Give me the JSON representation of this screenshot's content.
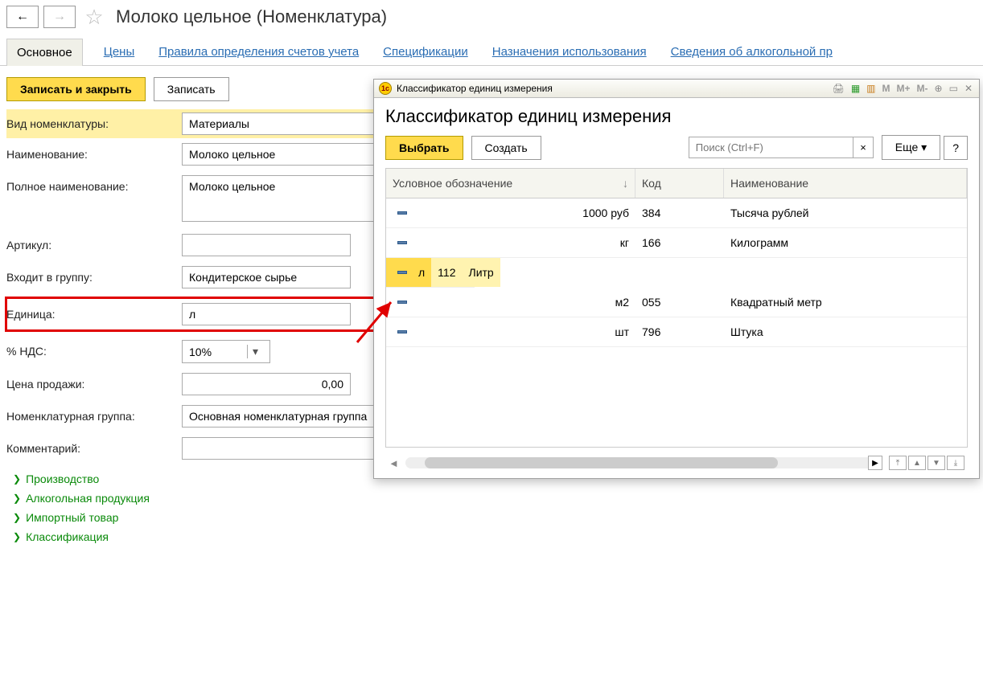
{
  "page_title": "Молоко цельное (Номенклатура)",
  "tabs": [
    "Основное",
    "Цены",
    "Правила определения счетов учета",
    "Спецификации",
    "Назначения использования",
    "Сведения об алкогольной пр"
  ],
  "toolbar": {
    "save_close": "Записать и закрыть",
    "save": "Записать"
  },
  "form": {
    "kind_label": "Вид номенклатуры:",
    "kind_value": "Материалы",
    "name_label": "Наименование:",
    "name_value": "Молоко цельное",
    "fullname_label": "Полное наименование:",
    "fullname_value": "Молоко цельное",
    "article_label": "Артикул:",
    "article_value": "",
    "group_label": "Входит в группу:",
    "group_value": "Кондитерское сырье",
    "unit_label": "Единица:",
    "unit_value": "л",
    "vat_label": "% НДС:",
    "vat_value": "10%",
    "price_label": "Цена продажи:",
    "price_value": "0,00",
    "nomgrp_label": "Номенклатурная группа:",
    "nomgrp_value": "Основная номенклатурная группа",
    "comment_label": "Комментарий:",
    "comment_value": ""
  },
  "sections": [
    "Производство",
    "Алкогольная продукция",
    "Импортный товар",
    "Классификация"
  ],
  "dialog": {
    "window_title": "Классификатор единиц измерения",
    "heading": "Классификатор единиц измерения",
    "select_btn": "Выбрать",
    "create_btn": "Создать",
    "search_placeholder": "Поиск (Ctrl+F)",
    "more_btn": "Еще",
    "help_btn": "?",
    "cols": {
      "c1": "Условное обозначение",
      "c2": "Код",
      "c3": "Наименование"
    },
    "rows": [
      {
        "sym": "1000 руб",
        "code": "384",
        "name": "Тысяча рублей"
      },
      {
        "sym": "кг",
        "code": "166",
        "name": "Килограмм"
      },
      {
        "sym": "л",
        "code": "112",
        "name": "Литр"
      },
      {
        "sym": "м2",
        "code": "055",
        "name": "Квадратный метр"
      },
      {
        "sym": "шт",
        "code": "796",
        "name": "Штука"
      }
    ],
    "titlebar_icons": {
      "m": "M",
      "mp": "M+",
      "mm": "M-"
    }
  }
}
